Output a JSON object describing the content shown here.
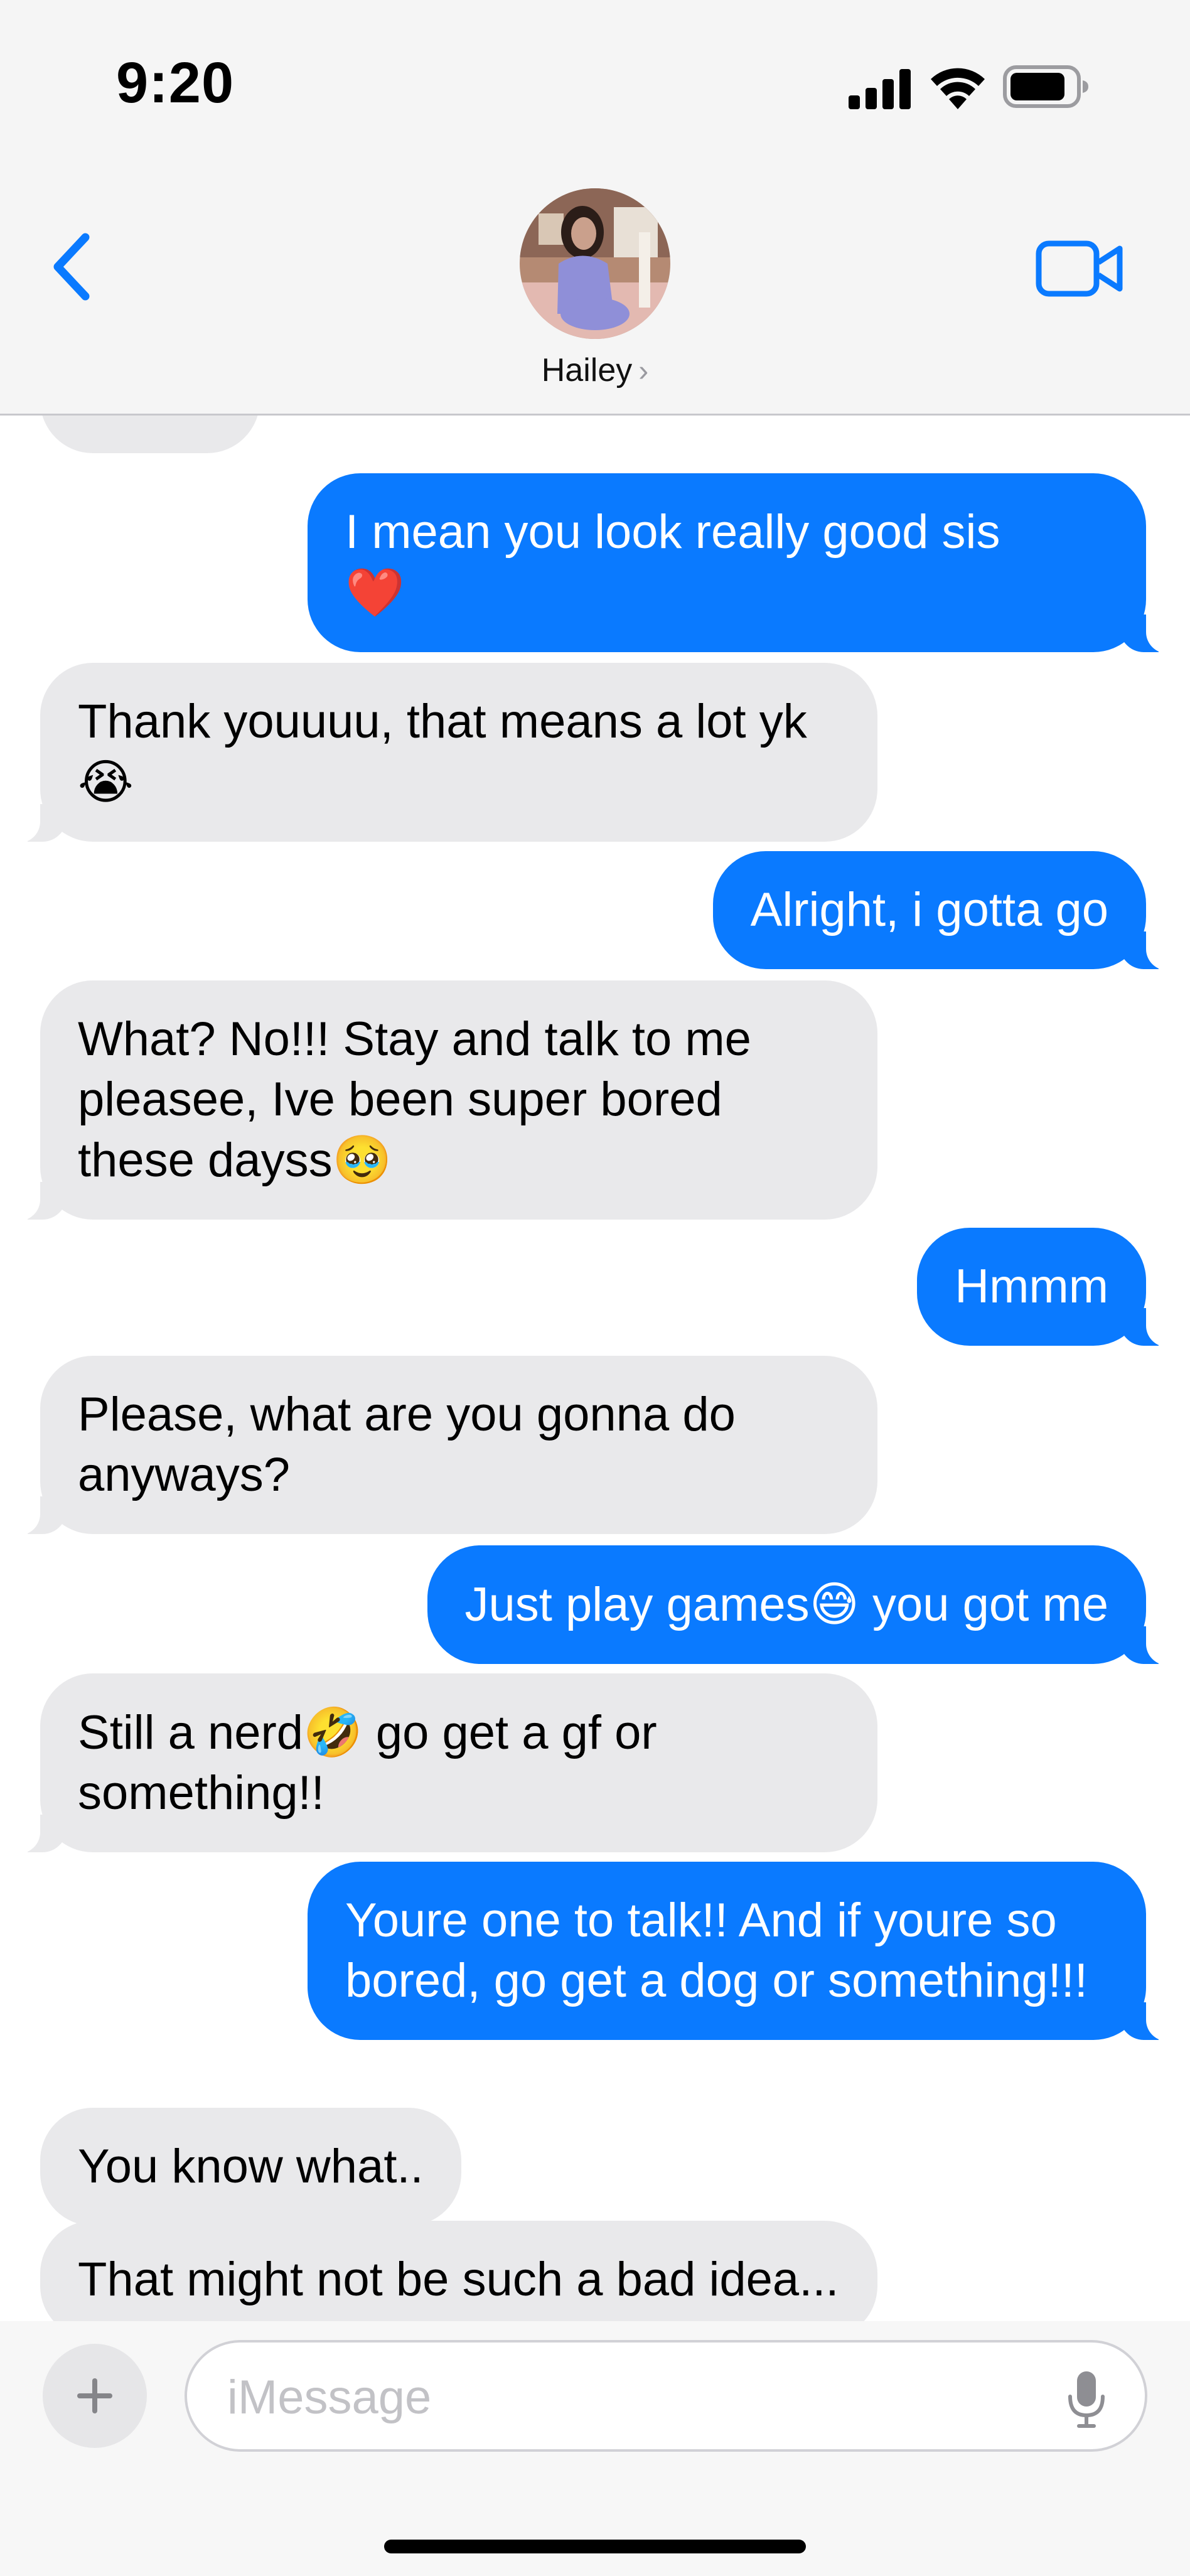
{
  "status_bar": {
    "time": "9:20"
  },
  "header": {
    "contact_name": "Hailey",
    "chevron": "›"
  },
  "messages": [
    {
      "side": "out",
      "text": "I mean you look really good sis",
      "emoji": "❤️"
    },
    {
      "side": "in",
      "text": "Thank youuuu, that means a lot yk",
      "emoji": "😭"
    },
    {
      "side": "out",
      "text": "Alright, i gotta go"
    },
    {
      "side": "in",
      "text": "What? No!!! Stay and talk to me pleasee, Ive been super bored these dayss",
      "emoji": "🥹"
    },
    {
      "side": "out",
      "text": "Hmmm"
    },
    {
      "side": "in",
      "text": "Please, what are you gonna do anyways?"
    },
    {
      "side": "out",
      "text_before": "Just play games",
      "emoji": "😅",
      "text_after": " you got me"
    },
    {
      "side": "in",
      "text_before": "Still a nerd",
      "emoji": "🤣",
      "text_after": " go get a gf or something!!"
    },
    {
      "side": "out",
      "text": "Youre one to talk!! And if youre so bored, go get a dog or something!!!"
    },
    {
      "side": "in",
      "text": "You know what.."
    },
    {
      "side": "in",
      "text": "That might not be such a bad idea..."
    }
  ],
  "compose": {
    "placeholder": "iMessage"
  },
  "colors": {
    "outgoing_bubble": "#0a7aff",
    "incoming_bubble": "#e9e9eb",
    "accent": "#0a7aff"
  },
  "icons": {
    "back": "chevron-left-icon",
    "video": "video-camera-icon",
    "plus": "plus-icon",
    "mic": "microphone-icon"
  }
}
